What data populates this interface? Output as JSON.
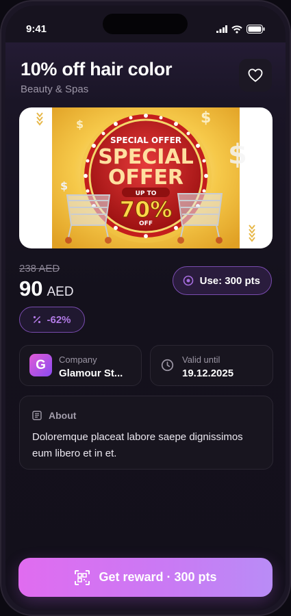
{
  "status_bar": {
    "time": "9:41"
  },
  "offer": {
    "title": "10% off hair color",
    "category": "Beauty & Spas",
    "old_price": "238 AED",
    "price": "90",
    "currency": "AED",
    "use_label": "Use: 300 pts",
    "discount": "-62%"
  },
  "banner": {
    "top_text": "SPECIAL OFFER",
    "main_line1": "SPECIAL",
    "main_line2": "OFFER",
    "up_to": "UP TO",
    "percent": "70%",
    "off": "OFF"
  },
  "company": {
    "label": "Company",
    "value": "Glamour St...",
    "logo_letter": "G"
  },
  "validity": {
    "label": "Valid until",
    "value": "19.12.2025"
  },
  "about": {
    "label": "About",
    "text": "Doloremque placeat labore saepe dignissimos eum libero et in et."
  },
  "cta": {
    "label": "Get reward · 300 pts"
  },
  "colors": {
    "accent": "#c97af4",
    "discount_text": "#b27ae6",
    "border_accent": "#7a4cb0"
  },
  "icons": {
    "favorite": "heart-icon",
    "use": "target-icon",
    "discount": "percent-icon",
    "valid": "clock-icon",
    "about": "document-icon",
    "cta": "qr-scan-icon"
  }
}
